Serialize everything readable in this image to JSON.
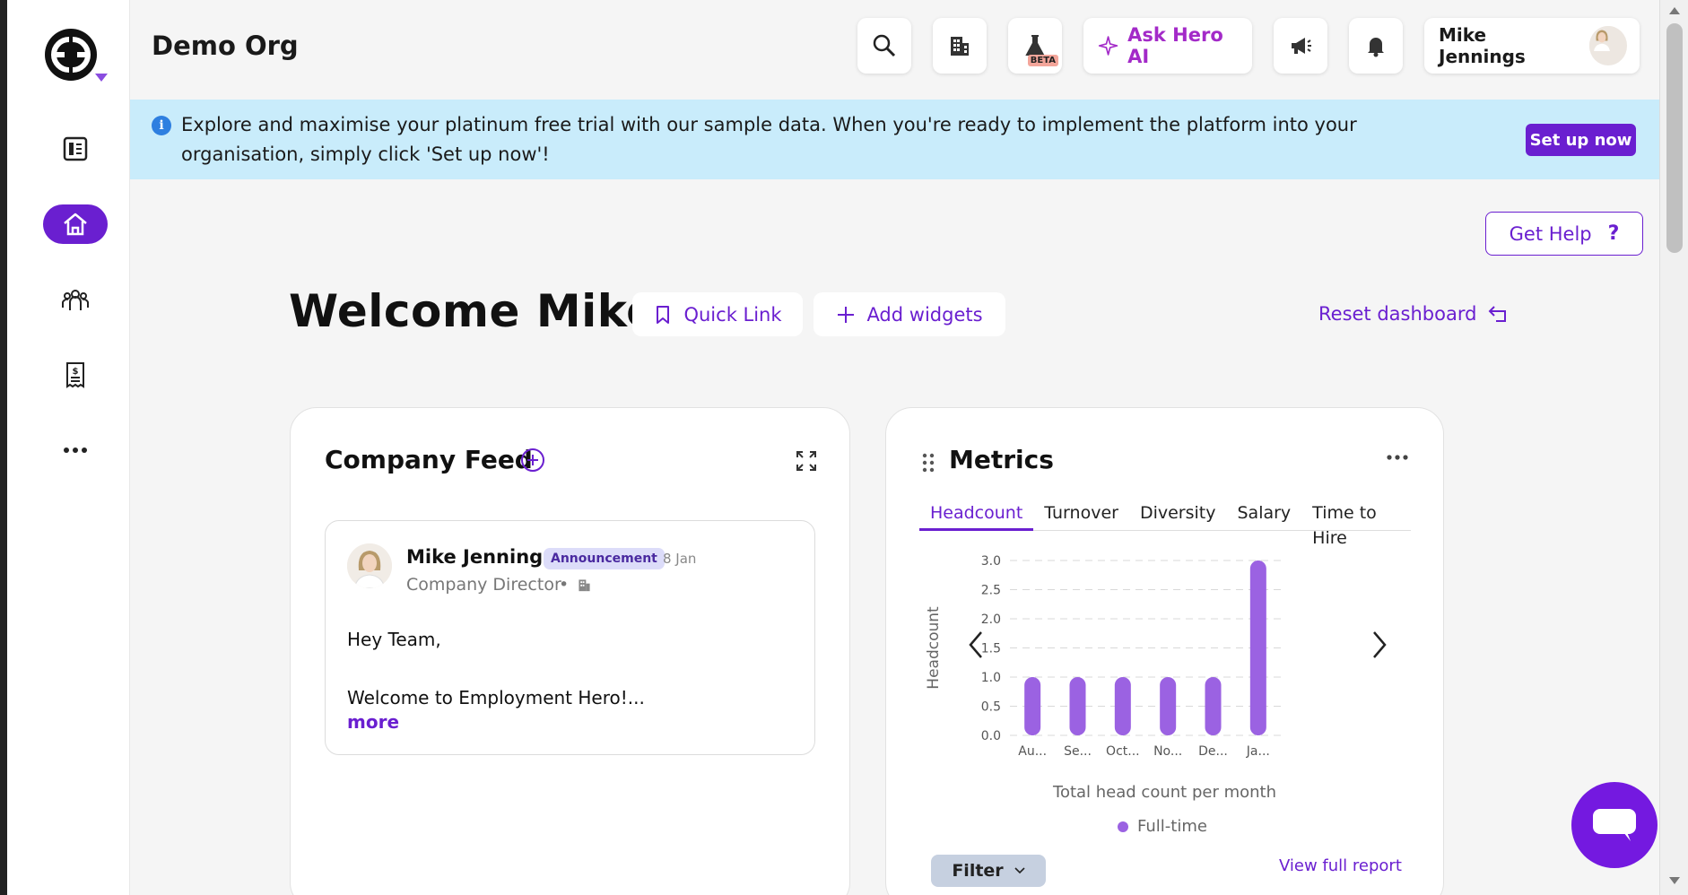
{
  "topbar": {
    "org_name": "Demo Org",
    "ask_hero_label": "Ask Hero AI",
    "beta_label": "BETA",
    "user_name": "Mike Jennings"
  },
  "banner": {
    "text": "Explore and maximise your platinum free trial with our sample data. When you're ready to implement the platform into your organisation, simply click 'Set up now'!",
    "info_glyph": "i",
    "setup_label": "Set up now"
  },
  "main": {
    "get_help_label": "Get Help",
    "get_help_glyph": "?",
    "welcome": "Welcome Mike",
    "quick_link_label": "Quick Link",
    "add_widgets_label": "Add widgets",
    "reset_label": "Reset dashboard"
  },
  "feed": {
    "title": "Company Feed",
    "post": {
      "author": "Mike Jennings",
      "badge": "Announcement",
      "date": "8 Jan",
      "role": "Company Director",
      "separator": "•",
      "greeting": "Hey Team,",
      "excerpt": "Welcome to Employment Hero!...",
      "more_label": "more"
    }
  },
  "metrics": {
    "title": "Metrics",
    "tabs": [
      "Headcount",
      "Turnover",
      "Diversity",
      "Salary",
      "Time to Hire"
    ],
    "active_tab": "Headcount",
    "filter_label": "Filter",
    "view_report_label": "View full report"
  },
  "chart_data": {
    "type": "bar",
    "categories": [
      "Au...",
      "Se...",
      "Oct...",
      "No...",
      "De...",
      "Ja..."
    ],
    "series": [
      {
        "name": "Full-time",
        "values": [
          1,
          1,
          1,
          1,
          1,
          3
        ]
      }
    ],
    "ylabel": "Headcount",
    "xlabel": "Total head count per month",
    "ylim": [
      0,
      3
    ],
    "yticks": [
      "0.0",
      "0.5",
      "1.0",
      "1.5",
      "2.0",
      "2.5",
      "3.0"
    ],
    "grid": true,
    "legend": "bottom",
    "color": "#9b62e2"
  },
  "colors": {
    "accent": "#6a1fd0",
    "banner_bg": "#c9ecfb",
    "ai_accent": "#a32ac8"
  }
}
